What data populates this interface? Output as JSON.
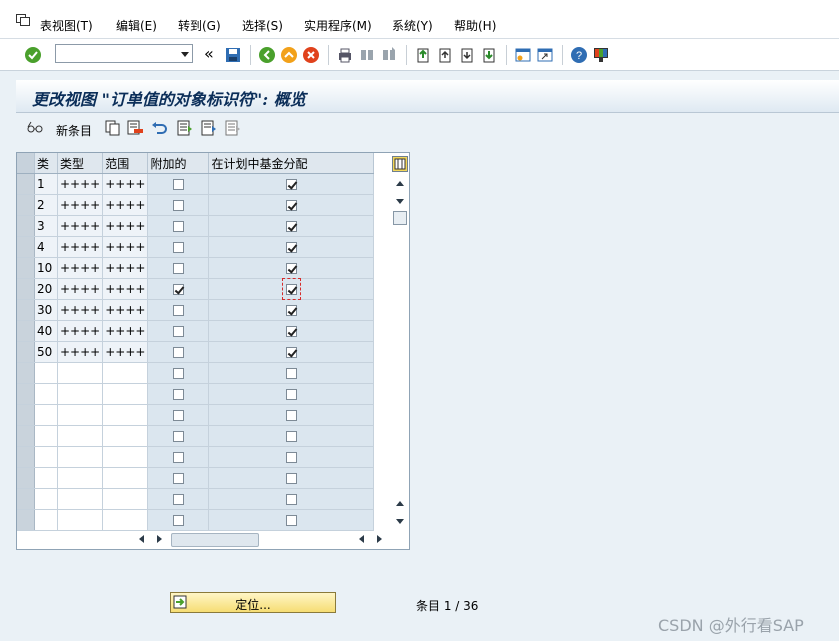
{
  "menu": {
    "items": [
      "表视图(T)",
      "编辑(E)",
      "转到(G)",
      "选择(S)",
      "实用程序(M)",
      "系统(Y)",
      "帮助(H)"
    ]
  },
  "toolbar": {
    "command_value": "",
    "icons": [
      "check-icon",
      "dropdown-icon",
      "collapse-icon",
      "save-icon",
      "back-icon",
      "exit-icon",
      "cancel-icon",
      "print-icon",
      "find-icon",
      "find-next-icon",
      "first-page-icon",
      "prev-page-icon",
      "next-page-icon",
      "last-page-icon",
      "create-session-icon",
      "shortcut-icon",
      "help-icon",
      "customize-layout-icon"
    ]
  },
  "title": "更改视图 \"订单值的对象标识符\": 概览",
  "app_toolbar": {
    "new_entries_label": "新条目",
    "icons": [
      "glasses-icon",
      "copy-icon",
      "delete-icon",
      "undo-icon",
      "select-all-icon",
      "select-block-icon",
      "deselect-all-icon"
    ]
  },
  "table": {
    "columns": [
      "类",
      "类型",
      "范围",
      "附加的",
      "在计划中基金分配"
    ],
    "rows": [
      {
        "cls": "1",
        "type": "++++",
        "range": "++++",
        "additional": false,
        "fund": true
      },
      {
        "cls": "2",
        "type": "++++",
        "range": "++++",
        "additional": false,
        "fund": true
      },
      {
        "cls": "3",
        "type": "++++",
        "range": "++++",
        "additional": false,
        "fund": true
      },
      {
        "cls": "4",
        "type": "++++",
        "range": "++++",
        "additional": false,
        "fund": true
      },
      {
        "cls": "10",
        "type": "++++",
        "range": "++++",
        "additional": false,
        "fund": true
      },
      {
        "cls": "20",
        "type": "++++",
        "range": "++++",
        "additional": true,
        "fund": true,
        "focus": true
      },
      {
        "cls": "30",
        "type": "++++",
        "range": "++++",
        "additional": false,
        "fund": true
      },
      {
        "cls": "40",
        "type": "++++",
        "range": "++++",
        "additional": false,
        "fund": true
      },
      {
        "cls": "50",
        "type": "++++",
        "range": "++++",
        "additional": false,
        "fund": true
      },
      {
        "cls": "",
        "type": "",
        "range": "",
        "additional": false,
        "fund": false
      },
      {
        "cls": "",
        "type": "",
        "range": "",
        "additional": false,
        "fund": false
      },
      {
        "cls": "",
        "type": "",
        "range": "",
        "additional": false,
        "fund": false
      },
      {
        "cls": "",
        "type": "",
        "range": "",
        "additional": false,
        "fund": false
      },
      {
        "cls": "",
        "type": "",
        "range": "",
        "additional": false,
        "fund": false
      },
      {
        "cls": "",
        "type": "",
        "range": "",
        "additional": false,
        "fund": false
      },
      {
        "cls": "",
        "type": "",
        "range": "",
        "additional": false,
        "fund": false
      },
      {
        "cls": "",
        "type": "",
        "range": "",
        "additional": false,
        "fund": false
      }
    ]
  },
  "bottom": {
    "position_button": "定位...",
    "entries": "条目 1 / 36"
  },
  "watermark": "CSDN @外行看SAP",
  "colors": {
    "accent": "#0b2e59",
    "button_yellow": "#f6dd74",
    "focus_red": "#d62b2b"
  }
}
